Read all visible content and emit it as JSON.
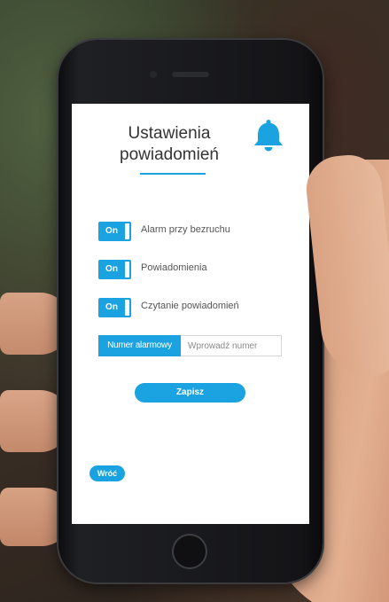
{
  "header": {
    "title_line1": "Ustawienia",
    "title_line2": "powiadomień",
    "icon": "bell-icon",
    "accent_color": "#1aa3e0"
  },
  "toggles": [
    {
      "state_label": "On",
      "label": "Alarm przy bezruchu",
      "checked": true
    },
    {
      "state_label": "On",
      "label": "Powiadomienia",
      "checked": true
    },
    {
      "state_label": "On",
      "label": "Czytanie powiadomień",
      "checked": true
    }
  ],
  "alarm_number": {
    "label": "Numer alarmowy",
    "placeholder": "Wprowadź numer",
    "value": ""
  },
  "actions": {
    "save_label": "Zapisz",
    "back_label": "Wróć"
  }
}
